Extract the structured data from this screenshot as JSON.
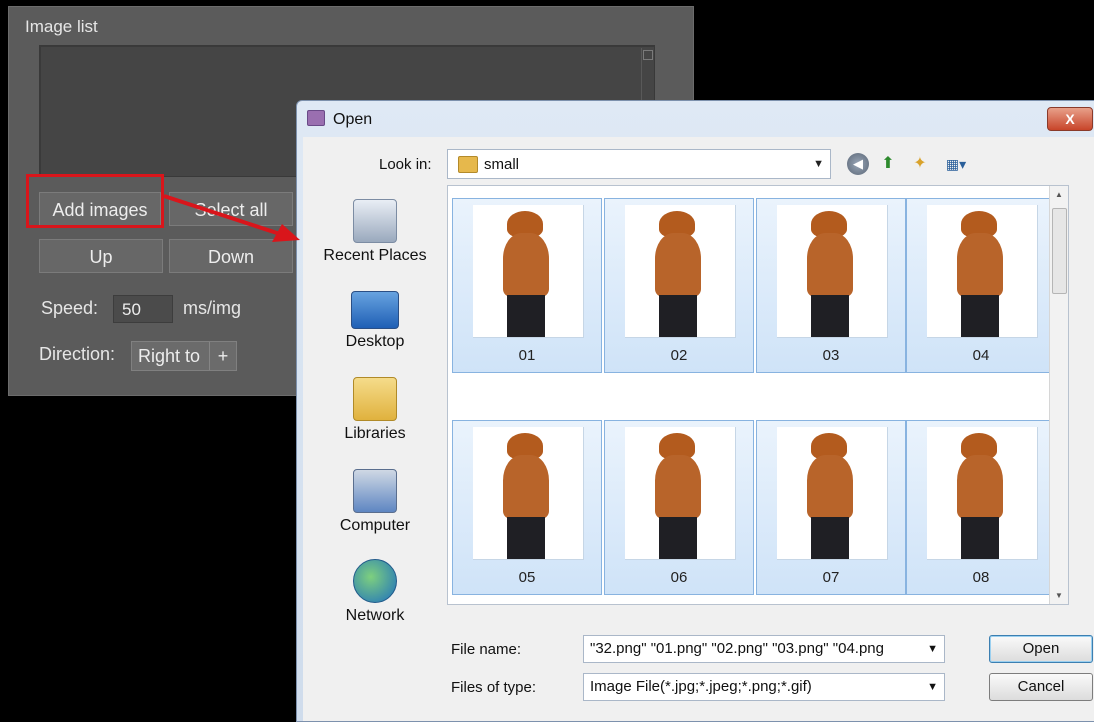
{
  "panel": {
    "title": "Image list",
    "add_images": "Add images",
    "select_all": "Select all",
    "up": "Up",
    "down": "Down",
    "speed_label": "Speed:",
    "speed_value": "50",
    "speed_unit": "ms/img",
    "direction_label": "Direction:",
    "direction_value": "Right to",
    "direction_plus": "+"
  },
  "dialog": {
    "title": "Open",
    "close": "X",
    "look_in_label": "Look in:",
    "look_in_value": "small",
    "places": [
      "Recent Places",
      "Desktop",
      "Libraries",
      "Computer",
      "Network"
    ],
    "thumbs": [
      "01",
      "02",
      "03",
      "04",
      "05",
      "06",
      "07",
      "08"
    ],
    "file_name_label": "File name:",
    "file_name_value": "\"32.png\" \"01.png\" \"02.png\" \"03.png\" \"04.png",
    "file_type_label": "Files of type:",
    "file_type_value": "Image File(*.jpg;*.jpeg;*.png;*.gif)",
    "open": "Open",
    "cancel": "Cancel"
  },
  "colors": {
    "highlight": "#d9151b",
    "panel_bg": "#5b5b5b",
    "selected_thumb": "#cfe3f8"
  }
}
